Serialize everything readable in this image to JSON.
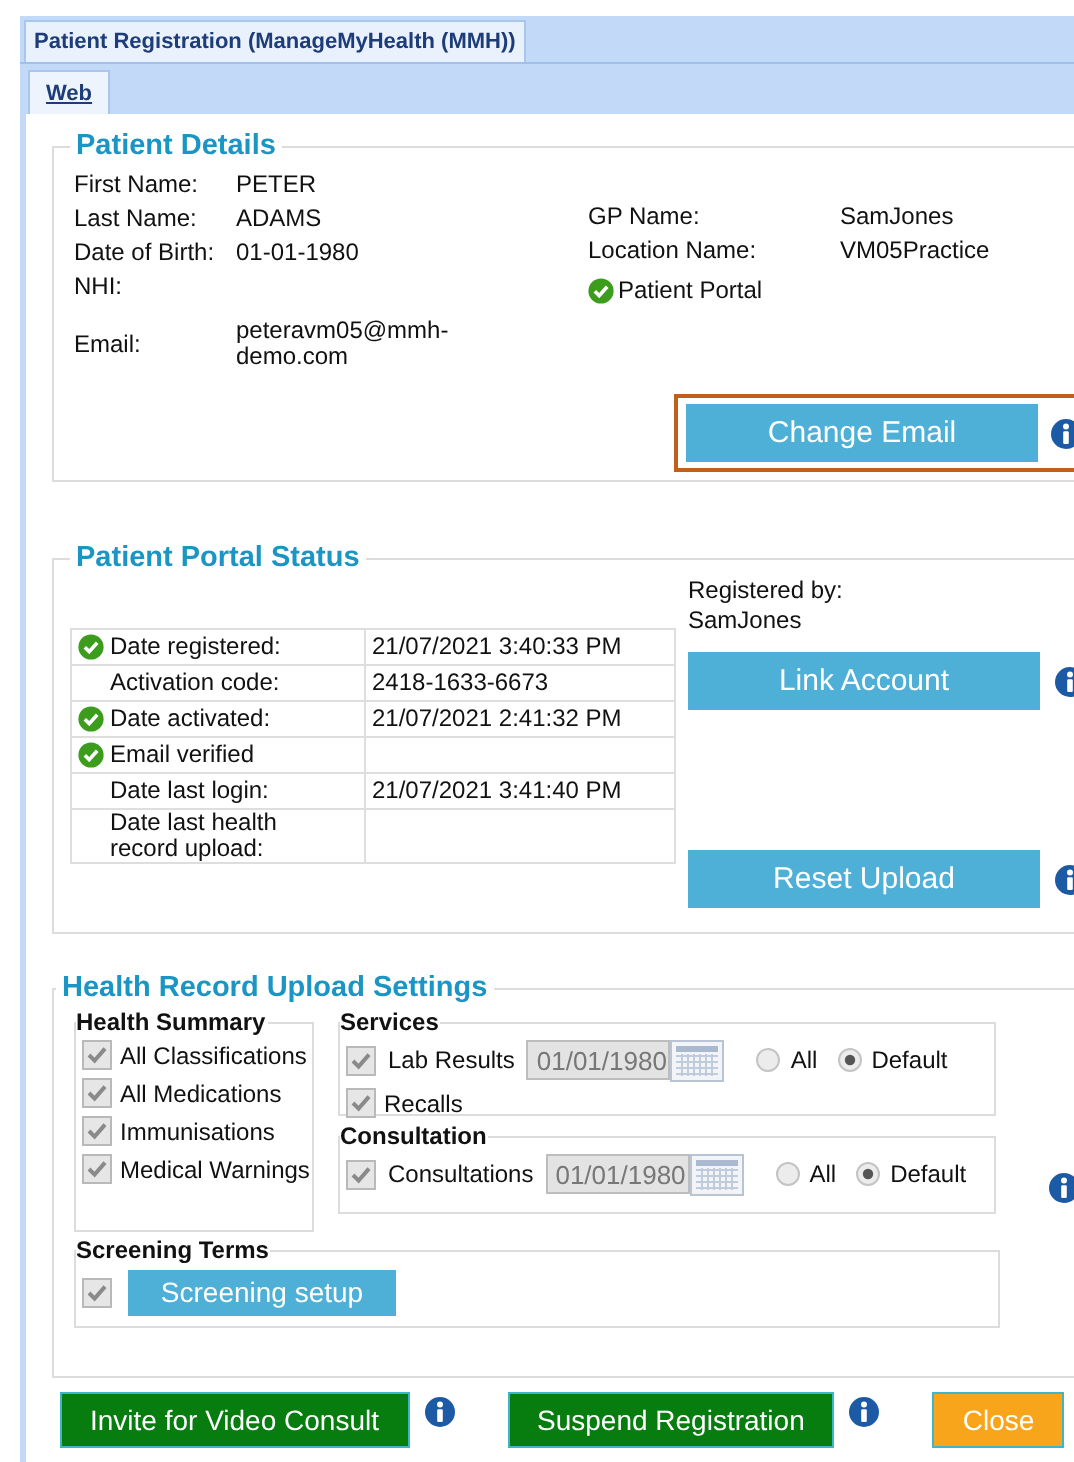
{
  "window": {
    "title": "Patient Registration (ManageMyHealth (MMH))"
  },
  "tabs": [
    {
      "label": "Web",
      "selected": true
    }
  ],
  "patient_details": {
    "title": "Patient Details",
    "fields": [
      {
        "label": "First Name:",
        "value": "PETER"
      },
      {
        "label": "Last Name:",
        "value": "ADAMS"
      },
      {
        "label": "Date of Birth:",
        "value": "01-01-1980"
      },
      {
        "label": "NHI:"
      },
      {
        "label": "Email:",
        "value": "peteravm05@mmh-demo.com"
      }
    ],
    "practice_fields": [
      {
        "label": "GP Name:",
        "value": "SamJones"
      },
      {
        "label": "Location Name:",
        "value": "VM05Practice"
      }
    ],
    "portal": {
      "label": "Patient Portal",
      "verified": true
    },
    "change_email": {
      "label": "Change Email",
      "highlighted": true
    }
  },
  "portal_status": {
    "title": "Patient Portal Status",
    "rows": [
      {
        "label": "Date registered:",
        "value": "21/07/2021 3:40:33 PM",
        "verified": true
      },
      {
        "label": "Activation code:",
        "value": "2418-1633-6673",
        "verified": false
      },
      {
        "label": "Date activated:",
        "value": "21/07/2021 2:41:32 PM",
        "verified": true
      },
      {
        "label": "Email verified",
        "verified": true
      },
      {
        "label": "Date last login:",
        "value": "21/07/2021 3:41:40 PM",
        "verified": false
      },
      {
        "label": "Date last health record upload:",
        "verified": false
      }
    ],
    "registered_by_label": "Registered by:",
    "registered_by": "SamJones",
    "link_button": "Link Account",
    "reset_button": "Reset Upload"
  },
  "upload_settings": {
    "title": "Health Record Upload Settings",
    "health_summary": {
      "title": "Health Summary",
      "items": [
        {
          "label": "All Classifications",
          "checked": true
        },
        {
          "label": "All Medications",
          "checked": true
        },
        {
          "label": "Immunisations",
          "checked": true
        },
        {
          "label": "Medical Warnings",
          "checked": true
        }
      ]
    },
    "services": {
      "title": "Services",
      "items": [
        {
          "kind": "dated",
          "label": "Lab Results",
          "checked": true,
          "date": "01/01/1980",
          "options": [
            {
              "label": "All",
              "selected": false
            },
            {
              "label": "Default",
              "selected": true
            }
          ]
        },
        {
          "kind": "plain",
          "label": "Recalls",
          "checked": true
        }
      ]
    },
    "consultation": {
      "title": "Consultation",
      "items": [
        {
          "kind": "dated",
          "label": "Consultations",
          "checked": true,
          "date": "01/01/1980",
          "options": [
            {
              "label": "All",
              "selected": false
            },
            {
              "label": "Default",
              "selected": true
            }
          ]
        }
      ]
    },
    "screening": {
      "title": "Screening Terms",
      "checked": true,
      "button": "Screening setup"
    }
  },
  "footer": [
    {
      "kind": "button",
      "label": "Invite for Video Consult",
      "color": "#067d0e"
    },
    {
      "kind": "info"
    },
    {
      "kind": "button",
      "label": "Suspend Registration",
      "color": "#067d0e"
    },
    {
      "kind": "info"
    },
    {
      "kind": "button",
      "label": "Close",
      "color": "#f8a51c"
    }
  ]
}
